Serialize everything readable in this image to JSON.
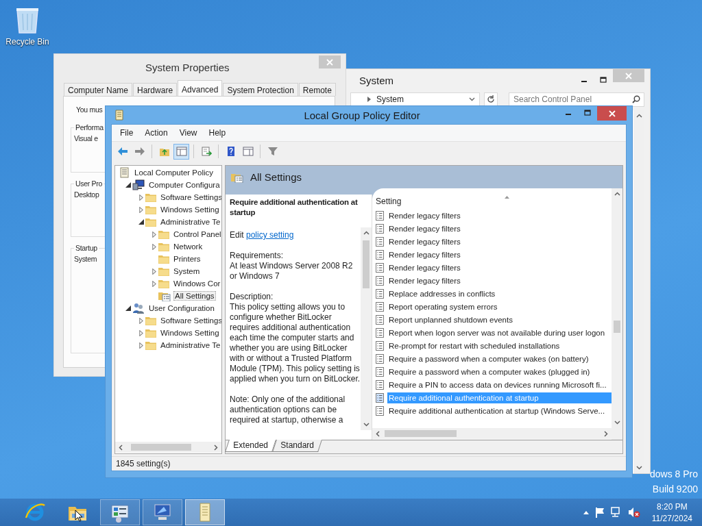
{
  "desktop": {
    "icons": [
      {
        "label": "Recycle Bin"
      }
    ],
    "watermark": [
      "dows 8 Pro",
      "Build 9200"
    ]
  },
  "system_properties": {
    "title": "System Properties",
    "tabs": [
      {
        "label": "Computer Name",
        "selected": false
      },
      {
        "label": "Hardware",
        "selected": false
      },
      {
        "label": "Advanced",
        "selected": true
      },
      {
        "label": "System Protection",
        "selected": false
      },
      {
        "label": "Remote",
        "selected": false
      }
    ],
    "intro": "You mus",
    "groups": [
      {
        "title": "Performa",
        "text": "Visual e"
      },
      {
        "title": "User Pro",
        "text": "Desktop"
      },
      {
        "title": "Startup",
        "text": "System"
      }
    ]
  },
  "system_window": {
    "title": "System",
    "address": "System",
    "search": {
      "placeholder": "Search Control Panel"
    }
  },
  "gpo": {
    "title": "Local Group Policy Editor",
    "menu": [
      "File",
      "Action",
      "View",
      "Help"
    ],
    "tree": [
      {
        "label": "Local Computer Policy",
        "kind": "policy",
        "expandable": false,
        "selected": false,
        "children": [
          {
            "label": "Computer Configura",
            "kind": "computer",
            "expandable": true,
            "expanded": true,
            "selected": false,
            "children": [
              {
                "label": "Software Settings",
                "kind": "folder",
                "expandable": true,
                "expanded": false,
                "selected": false
              },
              {
                "label": "Windows Setting",
                "kind": "folder",
                "expandable": true,
                "expanded": false,
                "selected": false
              },
              {
                "label": "Administrative Te",
                "kind": "folder",
                "expandable": true,
                "expanded": true,
                "selected": false,
                "children": [
                  {
                    "label": "Control Panel",
                    "kind": "folder",
                    "expandable": true,
                    "expanded": false,
                    "selected": false
                  },
                  {
                    "label": "Network",
                    "kind": "folder",
                    "expandable": true,
                    "expanded": false,
                    "selected": false
                  },
                  {
                    "label": "Printers",
                    "kind": "folder",
                    "expandable": false,
                    "selected": false
                  },
                  {
                    "label": "System",
                    "kind": "folder",
                    "expandable": true,
                    "expanded": false,
                    "selected": false
                  },
                  {
                    "label": "Windows Cor",
                    "kind": "folder",
                    "expandable": true,
                    "expanded": false,
                    "selected": false
                  },
                  {
                    "label": "All Settings",
                    "kind": "settings",
                    "expandable": false,
                    "selected": true
                  }
                ]
              }
            ]
          },
          {
            "label": "User Configuration",
            "kind": "user",
            "expandable": true,
            "expanded": true,
            "selected": false,
            "children": [
              {
                "label": "Software Settings",
                "kind": "folder",
                "expandable": true,
                "expanded": false,
                "selected": false
              },
              {
                "label": "Windows Setting",
                "kind": "folder",
                "expandable": true,
                "expanded": false,
                "selected": false
              },
              {
                "label": "Administrative Te",
                "kind": "folder",
                "expandable": true,
                "expanded": false,
                "selected": false
              }
            ]
          }
        ]
      }
    ],
    "header": "All Settings",
    "description": {
      "heading": "Require additional authentication at startup",
      "edit": "Edit ",
      "link": "policy setting",
      "requirements_label": "Requirements:",
      "requirements": "At least Windows Server 2008 R2 or Windows 7",
      "description_label": "Description:",
      "description": "This policy setting allows you to configure whether BitLocker requires additional authentication each time the computer starts and whether you are using BitLocker with or without a Trusted Platform Module (TPM). This policy setting is applied when you turn on BitLocker.",
      "note": "Note: Only one of the additional authentication options can be required at startup, otherwise a"
    },
    "column": "Setting",
    "rows": [
      {
        "label": "Render legacy filters",
        "selected": false
      },
      {
        "label": "Render legacy filters",
        "selected": false
      },
      {
        "label": "Render legacy filters",
        "selected": false
      },
      {
        "label": "Render legacy filters",
        "selected": false
      },
      {
        "label": "Render legacy filters",
        "selected": false
      },
      {
        "label": "Render legacy filters",
        "selected": false
      },
      {
        "label": "Replace addresses in conflicts",
        "selected": false
      },
      {
        "label": "Report operating system errors",
        "selected": false
      },
      {
        "label": "Report unplanned shutdown events",
        "selected": false
      },
      {
        "label": "Report when logon server was not available during user logon",
        "selected": false
      },
      {
        "label": "Re-prompt for restart with scheduled installations",
        "selected": false
      },
      {
        "label": "Require a password when a computer wakes (on battery)",
        "selected": false
      },
      {
        "label": "Require a password when a computer wakes (plugged in)",
        "selected": false
      },
      {
        "label": "Require a PIN to access data on devices running Microsoft fi...",
        "selected": false
      },
      {
        "label": "Require additional authentication at startup",
        "selected": true
      },
      {
        "label": "Require additional authentication at startup (Windows Serve...",
        "selected": false
      }
    ],
    "view_tabs": [
      {
        "label": "Extended",
        "selected": true
      },
      {
        "label": "Standard",
        "selected": false
      }
    ],
    "status_bar": "1845 setting(s)"
  },
  "taskbar": {
    "apps": [
      {
        "kind": "browser",
        "running": false,
        "selected": false
      },
      {
        "kind": "explorer",
        "running": false,
        "selected": false
      },
      {
        "kind": "control-panel",
        "running": true,
        "selected": false
      },
      {
        "kind": "system",
        "running": true,
        "selected": false
      },
      {
        "kind": "policy",
        "running": true,
        "selected": true
      }
    ],
    "clock": {
      "time": "8:20 PM",
      "date": "11/27/2024"
    }
  }
}
